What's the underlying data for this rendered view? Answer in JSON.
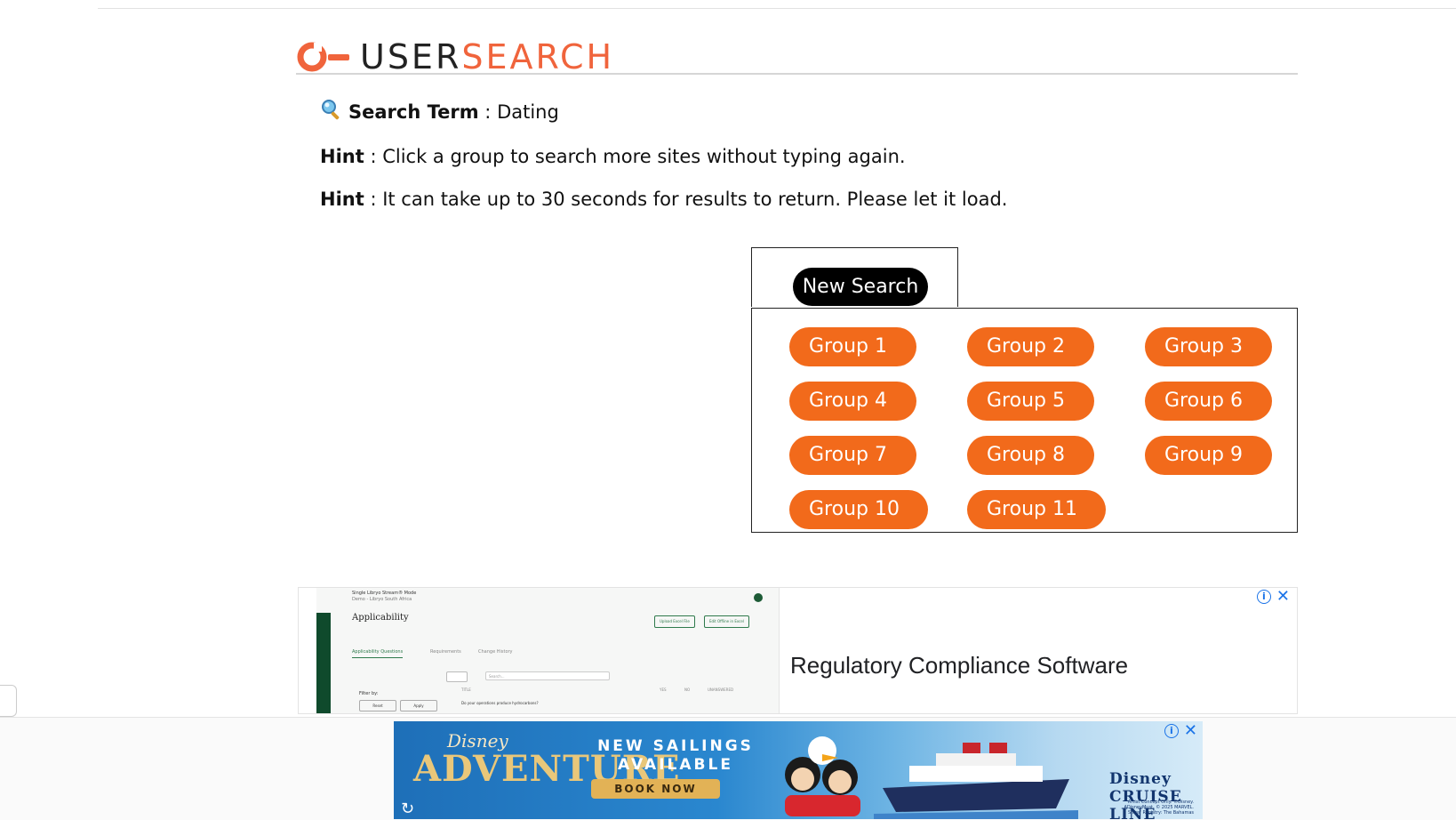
{
  "logo": {
    "part1": "USER",
    "part2": "SEARCH"
  },
  "info": {
    "search_term_label": "Search Term",
    "search_term_sep": " : ",
    "search_term_value": "Dating",
    "hint1_label": "Hint",
    "hint1_text": " : Click a group to search more sites without typing again.",
    "hint2_label": "Hint",
    "hint2_text": " : It can take up to 30 seconds for results to return. Please let it load."
  },
  "new_search_label": "New Search",
  "groups": [
    "Group 1",
    "Group 2",
    "Group 3",
    "Group 4",
    "Group 5",
    "Group 6",
    "Group 7",
    "Group 8",
    "Group 9",
    "Group 10",
    "Group 11"
  ],
  "ad1": {
    "title": "Regulatory Compliance Software",
    "shot_heading": "Applicability",
    "shot_tabs": [
      "Applicability Questions",
      "Requirements",
      "Change History"
    ],
    "shot_buttons": [
      "Upload Excel File",
      "Edit Offline in Excel"
    ],
    "shot_filter": "Filter by:",
    "shot_filter_buttons": [
      "Reset",
      "Apply"
    ],
    "shot_search_placeholder": "Search...",
    "shot_columns": [
      "TITLE",
      "YES",
      "NO",
      "UNANSWERED"
    ],
    "shot_top": "Single Libryo Stream® Mode",
    "shot_sub": "Demo - Libryo South Africa",
    "shot_row": "Do your operations produce hydrocarbons?"
  },
  "ad2": {
    "brand_top": "Disney",
    "brand_main": "ADVENTURE",
    "headline_line1": "NEW SAILINGS",
    "headline_line2": "AVAILABLE",
    "cta": "BOOK NOW",
    "cruise_brand": "Disney CRUISE LINE",
    "fine_print": "Artist Concept Only. ©Disney. ADisneyMust. © 2025 MARVEL. Ships' Registry: The Bahamas"
  },
  "colors": {
    "accent": "#f26a1b",
    "logo_orange": "#f0643c",
    "ad_blue": "#1a73e8"
  }
}
